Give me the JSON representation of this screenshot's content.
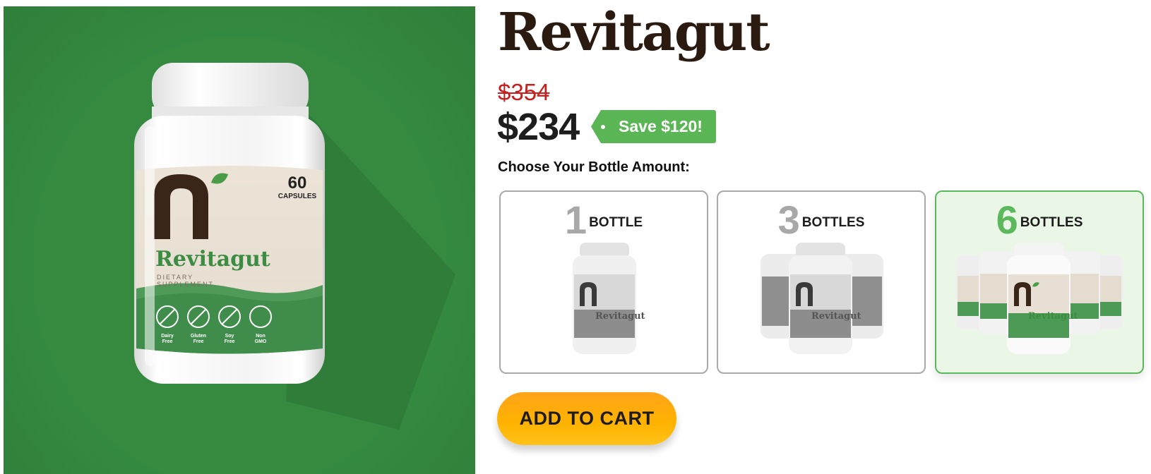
{
  "product": {
    "brand_name": "Revitagut",
    "old_price": "$354",
    "new_price": "$234",
    "save_label": "Save $120!"
  },
  "hero_bottle": {
    "label_brand": "Revitagut",
    "label_subtitle_line1": "DIETARY",
    "label_subtitle_line2": "SUPPLEMENT",
    "capsule_count": "60",
    "capsule_word": "CAPSULES",
    "badges": [
      {
        "line1": "Dairy",
        "line2": "Free"
      },
      {
        "line1": "Gluten",
        "line2": "Free"
      },
      {
        "line1": "Soy",
        "line2": "Free"
      },
      {
        "line1": "Non",
        "line2": "GMO"
      }
    ]
  },
  "selector": {
    "label": "Choose Your Bottle Amount:",
    "options": [
      {
        "number": "1",
        "word": "BOTTLE"
      },
      {
        "number": "3",
        "word": "BOTTLES"
      },
      {
        "number": "6",
        "word": "BOTTLES"
      }
    ],
    "selected_index": 2
  },
  "cart": {
    "button_label": "ADD TO CART"
  },
  "colors": {
    "hero_green": "#358a40",
    "brand_brown": "#2b1a0f",
    "old_price_red": "#c6201e",
    "badge_green": "#5ab554",
    "selected_green": "#5cb85c",
    "cart_orange": "#ffb300"
  }
}
